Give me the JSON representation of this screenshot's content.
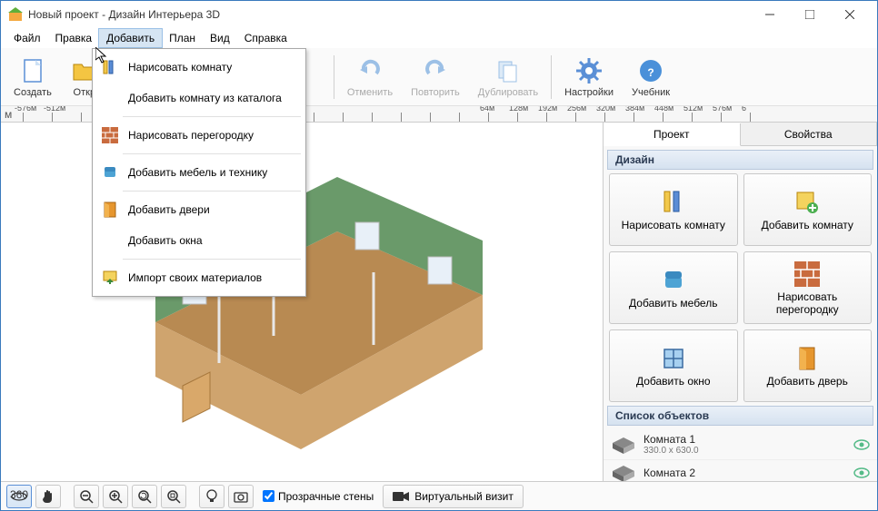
{
  "window": {
    "title": "Новый проект - Дизайн Интерьера 3D"
  },
  "menu": {
    "file": "Файл",
    "edit": "Правка",
    "add": "Добавить",
    "plan": "План",
    "view": "Вид",
    "help": "Справка"
  },
  "dropdown": {
    "draw_room": "Нарисовать комнату",
    "add_room_catalog": "Добавить комнату из каталога",
    "draw_partition": "Нарисовать перегородку",
    "add_furniture": "Добавить мебель и технику",
    "add_doors": "Добавить двери",
    "add_windows": "Добавить окна",
    "import_materials": "Импорт своих материалов"
  },
  "toolbar": {
    "create": "Создать",
    "open": "Откр",
    "undo": "Отменить",
    "redo": "Повторить",
    "duplicate": "Дублировать",
    "settings": "Настройки",
    "tutorial": "Учебник"
  },
  "ruler_start": "м",
  "ruler_ticks": [
    "-576м",
    "-512м",
    "",
    "",
    "",
    "",
    "",
    "",
    "",
    "",
    "",
    "",
    "",
    "",
    "",
    "",
    "64м",
    "128м",
    "192м",
    "256м",
    "320м",
    "384м",
    "448м",
    "512м",
    "576м",
    "6"
  ],
  "right": {
    "tab_project": "Проект",
    "tab_props": "Свойства",
    "section_design": "Дизайн",
    "btn_draw_room": "Нарисовать комнату",
    "btn_add_room": "Добавить комнату",
    "btn_add_furniture": "Добавить мебель",
    "btn_draw_partition": "Нарисовать перегородку",
    "btn_add_window": "Добавить окно",
    "btn_add_door": "Добавить дверь",
    "section_objects": "Список объектов",
    "obj1_name": "Комната 1",
    "obj1_dims": "330.0 x 630.0",
    "obj2_name": "Комната 2"
  },
  "bottom": {
    "transparent_walls": "Прозрачные стены",
    "virtual_visit": "Виртуальный визит"
  }
}
